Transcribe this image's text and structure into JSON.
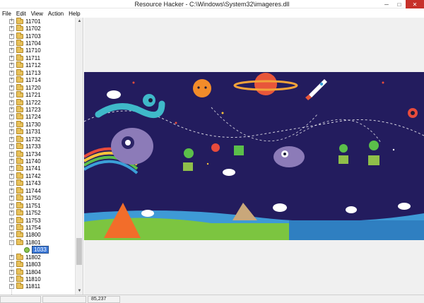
{
  "window": {
    "title": "Resource Hacker  -  C:\\Windows\\System32\\imageres.dll",
    "minimize_glyph": "─",
    "maximize_glyph": "□",
    "close_glyph": "✕"
  },
  "menu": [
    "File",
    "Edit",
    "View",
    "Action",
    "Help"
  ],
  "tree": {
    "items": [
      {
        "label": "11701"
      },
      {
        "label": "11702"
      },
      {
        "label": "11703"
      },
      {
        "label": "11704"
      },
      {
        "label": "11710"
      },
      {
        "label": "11711"
      },
      {
        "label": "11712"
      },
      {
        "label": "11713"
      },
      {
        "label": "11714"
      },
      {
        "label": "11720"
      },
      {
        "label": "11721"
      },
      {
        "label": "11722"
      },
      {
        "label": "11723"
      },
      {
        "label": "11724"
      },
      {
        "label": "11730"
      },
      {
        "label": "11731"
      },
      {
        "label": "11732"
      },
      {
        "label": "11733"
      },
      {
        "label": "11734"
      },
      {
        "label": "11740"
      },
      {
        "label": "11741"
      },
      {
        "label": "11742"
      },
      {
        "label": "11743"
      },
      {
        "label": "11744"
      },
      {
        "label": "11750"
      },
      {
        "label": "11751"
      },
      {
        "label": "11752"
      },
      {
        "label": "11753"
      },
      {
        "label": "11754"
      },
      {
        "label": "11800"
      },
      {
        "label": "11801",
        "expanded": true
      },
      {
        "label": "1033",
        "child": true,
        "selected": true
      },
      {
        "label": "11802"
      },
      {
        "label": "11803"
      },
      {
        "label": "11804"
      },
      {
        "label": "11810"
      },
      {
        "label": "11811"
      }
    ],
    "expanded_glyph": "−",
    "collapsed_glyph": "+"
  },
  "status": {
    "cell1": "",
    "cell2": "",
    "coords": "85,237"
  },
  "colors": {
    "art_background": "#231c5e",
    "selection": "#3b78d8",
    "close_button": "#c7312a"
  }
}
